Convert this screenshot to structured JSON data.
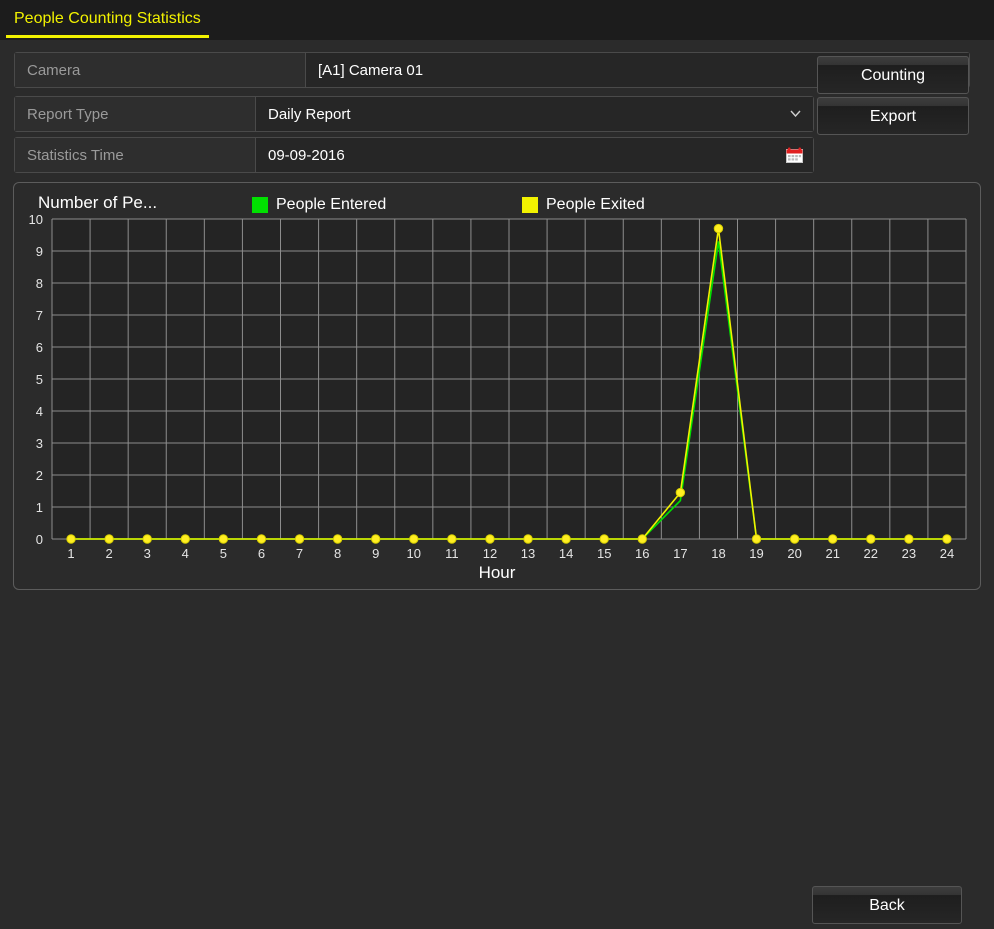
{
  "tab": {
    "label": "People Counting Statistics",
    "accent": "#f2f200"
  },
  "form": {
    "camera": {
      "label": "Camera",
      "value": "[A1] Camera 01",
      "icon": "chevron-down-icon"
    },
    "report_type": {
      "label": "Report Type",
      "value": "Daily Report",
      "icon": "chevron-down-icon"
    },
    "statistics_time": {
      "label": "Statistics Time",
      "value": "09-09-2016",
      "icon": "calendar-icon"
    }
  },
  "buttons": {
    "counting": "Counting",
    "export": "Export",
    "back": "Back"
  },
  "chart_data": {
    "type": "line",
    "title": "Number of Pe...",
    "xlabel": "Hour",
    "ylabel": "",
    "categories": [
      "1",
      "2",
      "3",
      "4",
      "5",
      "6",
      "7",
      "8",
      "9",
      "10",
      "11",
      "12",
      "13",
      "14",
      "15",
      "16",
      "17",
      "18",
      "19",
      "20",
      "21",
      "22",
      "23",
      "24"
    ],
    "ylim": [
      0,
      10
    ],
    "yticks": [
      "0",
      "1",
      "2",
      "3",
      "4",
      "5",
      "6",
      "7",
      "8",
      "9",
      "10"
    ],
    "grid": true,
    "legend_position": "top",
    "series": [
      {
        "name": "People Entered",
        "color": "#00e000",
        "values": [
          0,
          0,
          0,
          0,
          0,
          0,
          0,
          0,
          0,
          0,
          0,
          0,
          0,
          0,
          0,
          0,
          1.2,
          9.3,
          0,
          0,
          0,
          0,
          0,
          0
        ]
      },
      {
        "name": "People Exited",
        "color": "#f2f200",
        "values": [
          0,
          0,
          0,
          0,
          0,
          0,
          0,
          0,
          0,
          0,
          0,
          0,
          0,
          0,
          0,
          0,
          1.45,
          9.7,
          0,
          0,
          0,
          0,
          0,
          0
        ]
      }
    ]
  },
  "colors": {
    "entered": "#00e000",
    "exited": "#f2f200",
    "grid": "#8d8d8d",
    "plot_bg": "#242424",
    "marker": "#ffee22"
  }
}
